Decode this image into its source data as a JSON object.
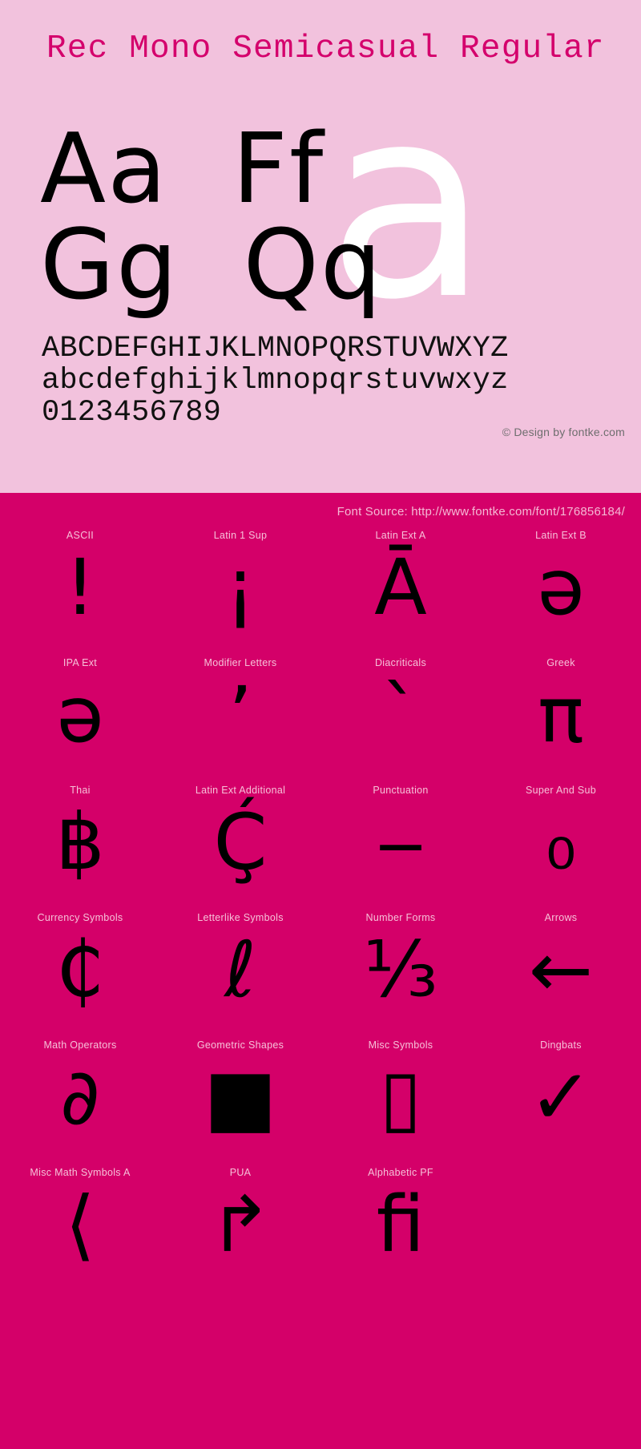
{
  "colors": {
    "top_background": "#f2c2dd",
    "bottom_background": "#d40069",
    "title_accent": "#d4006c",
    "hero_glyph": "#ffffff",
    "glyph_black": "#000000",
    "label_pink": "#f6c0d8",
    "credit_gray": "#6e6e6e"
  },
  "header": {
    "font_title": "Rec Mono Semicasual Regular"
  },
  "specimen": {
    "hero_glyph": "a",
    "letter_pairs_row1": "Aa  Ff",
    "letter_pairs_row2": "Gg  Qq",
    "uppercase": "ABCDEFGHIJKLMNOPQRSTUVWXYZ",
    "lowercase": "abcdefghijklmnopqrstuvwxyz",
    "digits": "0123456789",
    "credit": "© Design by fontke.com"
  },
  "source": {
    "label": "Font Source: http://www.fontke.com/font/176856184/"
  },
  "unicode_blocks": [
    {
      "label": "ASCII",
      "glyph": "!"
    },
    {
      "label": "Latin 1 Sup",
      "glyph": "¡"
    },
    {
      "label": "Latin Ext A",
      "glyph": "Ā"
    },
    {
      "label": "Latin Ext B",
      "glyph": "ə"
    },
    {
      "label": "IPA Ext",
      "glyph": "ə"
    },
    {
      "label": "Modifier Letters",
      "glyph": "ʼ"
    },
    {
      "label": "Diacriticals",
      "glyph": "ˋ"
    },
    {
      "label": "Greek",
      "glyph": "π"
    },
    {
      "label": "Thai",
      "glyph": "฿"
    },
    {
      "label": "Latin Ext Additional",
      "glyph": "Ḉ"
    },
    {
      "label": "Punctuation",
      "glyph": "‒"
    },
    {
      "label": "Super And Sub",
      "glyph": "₀"
    },
    {
      "label": "Currency Symbols",
      "glyph": "₵"
    },
    {
      "label": "Letterlike Symbols",
      "glyph": "ℓ"
    },
    {
      "label": "Number Forms",
      "glyph": "⅓"
    },
    {
      "label": "Arrows",
      "glyph": "←"
    },
    {
      "label": "Math Operators",
      "glyph": "∂"
    },
    {
      "label": "Geometric Shapes",
      "glyph": "■"
    },
    {
      "label": "Misc Symbols",
      "glyph": "▯"
    },
    {
      "label": "Dingbats",
      "glyph": "✓"
    },
    {
      "label": "Misc Math Symbols A",
      "glyph": "⟨"
    },
    {
      "label": "PUA",
      "glyph": "↱"
    },
    {
      "label": "Alphabetic PF",
      "glyph": "ﬁ"
    }
  ]
}
